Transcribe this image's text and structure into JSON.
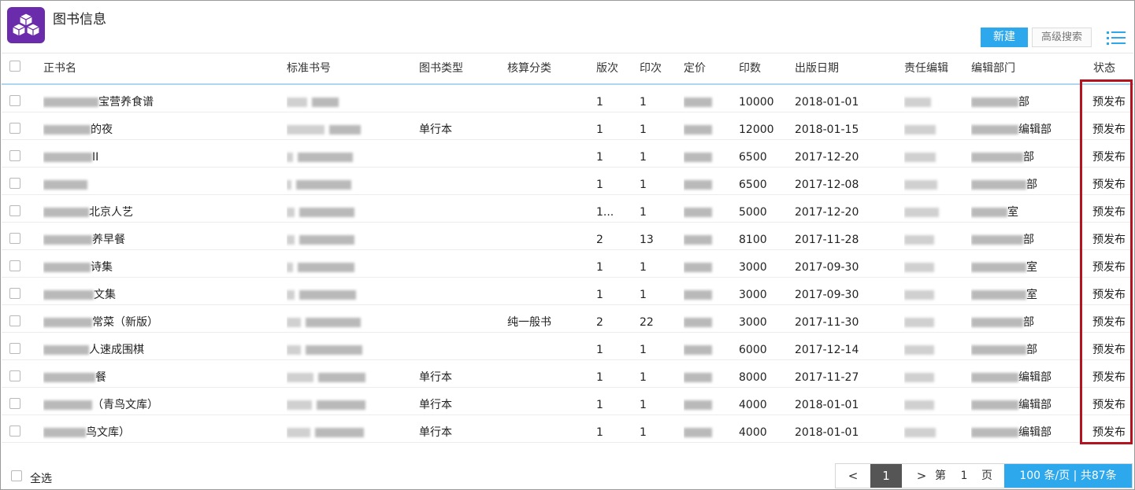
{
  "header": {
    "title": "图书信息",
    "new_label": "新建",
    "advanced_search_label": "高级搜索"
  },
  "columns": [
    "正书名",
    "标准书号",
    "图书类型",
    "核算分类",
    "版次",
    "印次",
    "定价",
    "印数",
    "出版日期",
    "责任编辑",
    "编辑部门",
    "状态"
  ],
  "rows": [
    {
      "name": "宝营养食谱",
      "book_type": "",
      "account": "",
      "edition": "1",
      "impression": "1",
      "print_run": "10000",
      "date": "2018-01-01",
      "editor": "",
      "dept": "部",
      "status": "预发布"
    },
    {
      "name": "的夜",
      "book_type": "单行本",
      "account": "",
      "edition": "1",
      "impression": "1",
      "print_run": "12000",
      "date": "2018-01-15",
      "editor": "",
      "dept": "编辑部",
      "status": "预发布"
    },
    {
      "name": "II",
      "book_type": "",
      "account": "",
      "edition": "1",
      "impression": "1",
      "print_run": "6500",
      "date": "2017-12-20",
      "editor": "",
      "dept": "部",
      "status": "预发布"
    },
    {
      "name": "",
      "book_type": "",
      "account": "",
      "edition": "1",
      "impression": "1",
      "print_run": "6500",
      "date": "2017-12-08",
      "editor": "",
      "dept": "部",
      "status": "预发布"
    },
    {
      "name": "北京人艺",
      "book_type": "",
      "account": "",
      "edition": "1...",
      "impression": "1",
      "print_run": "5000",
      "date": "2017-12-20",
      "editor": "",
      "dept": "室",
      "status": "预发布"
    },
    {
      "name": "养早餐",
      "book_type": "",
      "account": "",
      "edition": "2",
      "impression": "13",
      "print_run": "8100",
      "date": "2017-11-28",
      "editor": "",
      "dept": "部",
      "status": "预发布"
    },
    {
      "name": "诗集",
      "book_type": "",
      "account": "",
      "edition": "1",
      "impression": "1",
      "print_run": "3000",
      "date": "2017-09-30",
      "editor": "",
      "dept": "室",
      "status": "预发布"
    },
    {
      "name": "文集",
      "book_type": "",
      "account": "",
      "edition": "1",
      "impression": "1",
      "print_run": "3000",
      "date": "2017-09-30",
      "editor": "",
      "dept": "室",
      "status": "预发布"
    },
    {
      "name": "常菜（新版）",
      "book_type": "",
      "account": "纯一般书",
      "edition": "2",
      "impression": "22",
      "print_run": "3000",
      "date": "2017-11-30",
      "editor": "",
      "dept": "部",
      "status": "预发布"
    },
    {
      "name": "人速成围棋",
      "book_type": "",
      "account": "",
      "edition": "1",
      "impression": "1",
      "print_run": "6000",
      "date": "2017-12-14",
      "editor": "",
      "dept": "部",
      "status": "预发布"
    },
    {
      "name": "餐",
      "book_type": "单行本",
      "account": "",
      "edition": "1",
      "impression": "1",
      "print_run": "8000",
      "date": "2017-11-27",
      "editor": "",
      "dept": "编辑部",
      "status": "预发布"
    },
    {
      "name": "（青鸟文库）",
      "book_type": "单行本",
      "account": "",
      "edition": "1",
      "impression": "1",
      "print_run": "4000",
      "date": "2018-01-01",
      "editor": "",
      "dept": "编辑部",
      "status": "预发布"
    },
    {
      "name": "鸟文库）",
      "book_type": "单行本",
      "account": "",
      "edition": "1",
      "impression": "1",
      "print_run": "4000",
      "date": "2018-01-01",
      "editor": "",
      "dept": "编辑部",
      "status": "预发布"
    }
  ],
  "footer": {
    "select_all_label": "全选",
    "prev_label": "<",
    "current_page": "1",
    "next_label": ">",
    "page_prefix": "第",
    "page_number": "1",
    "page_suffix": "页",
    "page_size_label": "100 条/页 | 共87条"
  },
  "colors": {
    "brand": "#6a2cab",
    "accent": "#2ea8ec",
    "highlight_border": "#b3141f"
  },
  "icons": {
    "logo": "cubes-icon",
    "view_toggle": "list-icon"
  }
}
